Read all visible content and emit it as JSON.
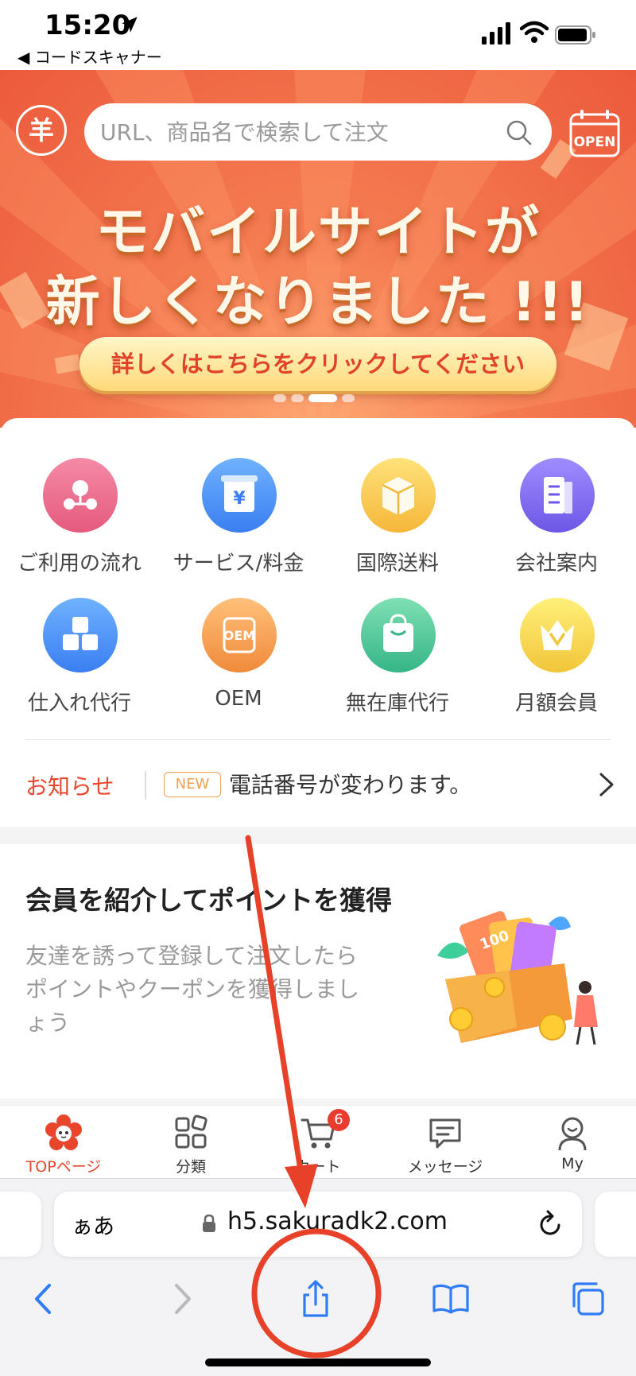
{
  "status_bar": {
    "time": "15:20",
    "back_label": "◀ コードスキャナー",
    "icons": [
      "location-arrow-icon",
      "signal-icon",
      "wifi-icon",
      "battery-icon"
    ]
  },
  "header": {
    "logo_glyph": "羊",
    "search_placeholder": "URL、商品名で検索して注文",
    "open_badge": "OPEN"
  },
  "banner": {
    "line1": "モバイルサイトが",
    "line2": "新しくなりました !!!",
    "cta": "詳しくはこちらをクリックしてください",
    "dots_total": 4,
    "active_dot": 3
  },
  "services": [
    {
      "label": "ご利用の流れ",
      "icon": "flow-icon"
    },
    {
      "label": "サービス/料金",
      "icon": "price-icon"
    },
    {
      "label": "国際送料",
      "icon": "shipping-box-icon"
    },
    {
      "label": "会社案内",
      "icon": "company-book-icon"
    },
    {
      "label": "仕入れ代行",
      "icon": "cubes-icon"
    },
    {
      "label": "OEM",
      "icon": "oem-icon"
    },
    {
      "label": "無在庫代行",
      "icon": "bag-icon"
    },
    {
      "label": "月額会員",
      "icon": "vip-crown-icon"
    }
  ],
  "notice": {
    "label": "お知らせ",
    "badge": "NEW",
    "text": "電話番号が変わります。"
  },
  "referral": {
    "title": "会員を紹介してポイントを獲得",
    "description": "友達を誘って登録して注文したらポイントやクーポンを獲得しましょう",
    "illustration_label": "100"
  },
  "tabbar": {
    "tabs": [
      {
        "label": "TOPページ",
        "icon": "sakura-home-icon",
        "active": true
      },
      {
        "label": "分類",
        "icon": "category-grid-icon"
      },
      {
        "label": "カート",
        "icon": "cart-icon",
        "badge": "6"
      },
      {
        "label": "メッセージ",
        "icon": "message-icon"
      },
      {
        "label": "My",
        "icon": "user-icon"
      }
    ]
  },
  "safari": {
    "aa_label": "ぁあ",
    "url": "h5.sakuradk2.com",
    "buttons": [
      "back-icon",
      "forward-icon",
      "share-icon",
      "bookmarks-icon",
      "tabs-icon"
    ]
  },
  "colors": {
    "brand_red": "#e8462b",
    "banner_orange": "#f06a44",
    "cta_yellow": "#ffe08a",
    "annotation_red": "#e8412a",
    "ios_blue": "#2f7cf6"
  }
}
